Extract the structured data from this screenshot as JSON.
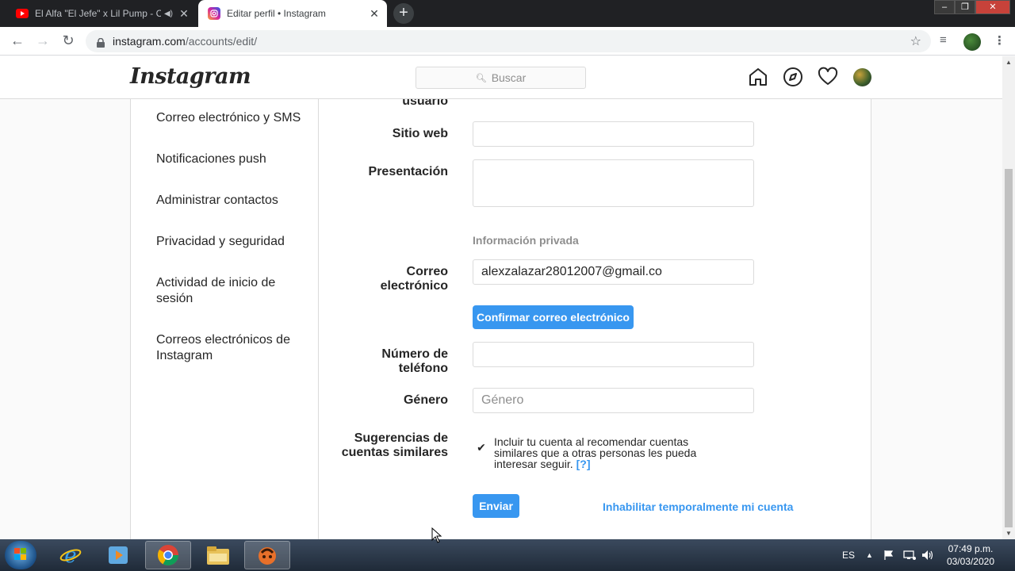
{
  "browser": {
    "tabs": [
      {
        "title": "El Alfa \"El Jefe\" x Lil Pump - C",
        "close": "✕"
      },
      {
        "title": "Editar perfil • Instagram",
        "close": "✕"
      }
    ],
    "new_tab": "+",
    "url_host": "instagram.com",
    "url_path": "/accounts/edit/"
  },
  "ig_header": {
    "logo": "Instagram",
    "search_placeholder": "Buscar"
  },
  "sidebar": {
    "items": [
      {
        "label": "Correo electrónico y SMS"
      },
      {
        "label": "Notificaciones push"
      },
      {
        "label": "Administrar contactos"
      },
      {
        "label": "Privacidad y seguridad"
      },
      {
        "label": "Actividad de inicio de sesión"
      },
      {
        "label": "Correos electrónicos de Instagram"
      }
    ]
  },
  "form": {
    "username_label_tail": "usuario",
    "website_label": "Sitio web",
    "website_value": "",
    "bio_label": "Presentación",
    "bio_value": "",
    "private_section": "Información privada",
    "email_label": "Correo electrónico",
    "email_value": "alexzalazar28012007@gmail.co",
    "confirm_email_button": "Confirmar correo electrónico",
    "phone_label": "Número de teléfono",
    "phone_value": "",
    "gender_label": "Género",
    "gender_placeholder": "Género",
    "suggestions_label": "Sugerencias de cuentas similares",
    "suggestions_checked": true,
    "suggestions_text": "Incluir tu cuenta al recomendar cuentas similares que a otras personas les pueda interesar seguir.",
    "suggestions_help": "[?]",
    "submit_button": "Enviar",
    "disable_account_link": "Inhabilitar temporalmente mi cuenta"
  },
  "taskbar": {
    "language": "ES",
    "time": "07:49 p.m.",
    "date": "03/03/2020"
  },
  "colors": {
    "ig_blue": "#3897f0",
    "chrome_dark": "#202124",
    "taskbar": "#2b3749"
  }
}
